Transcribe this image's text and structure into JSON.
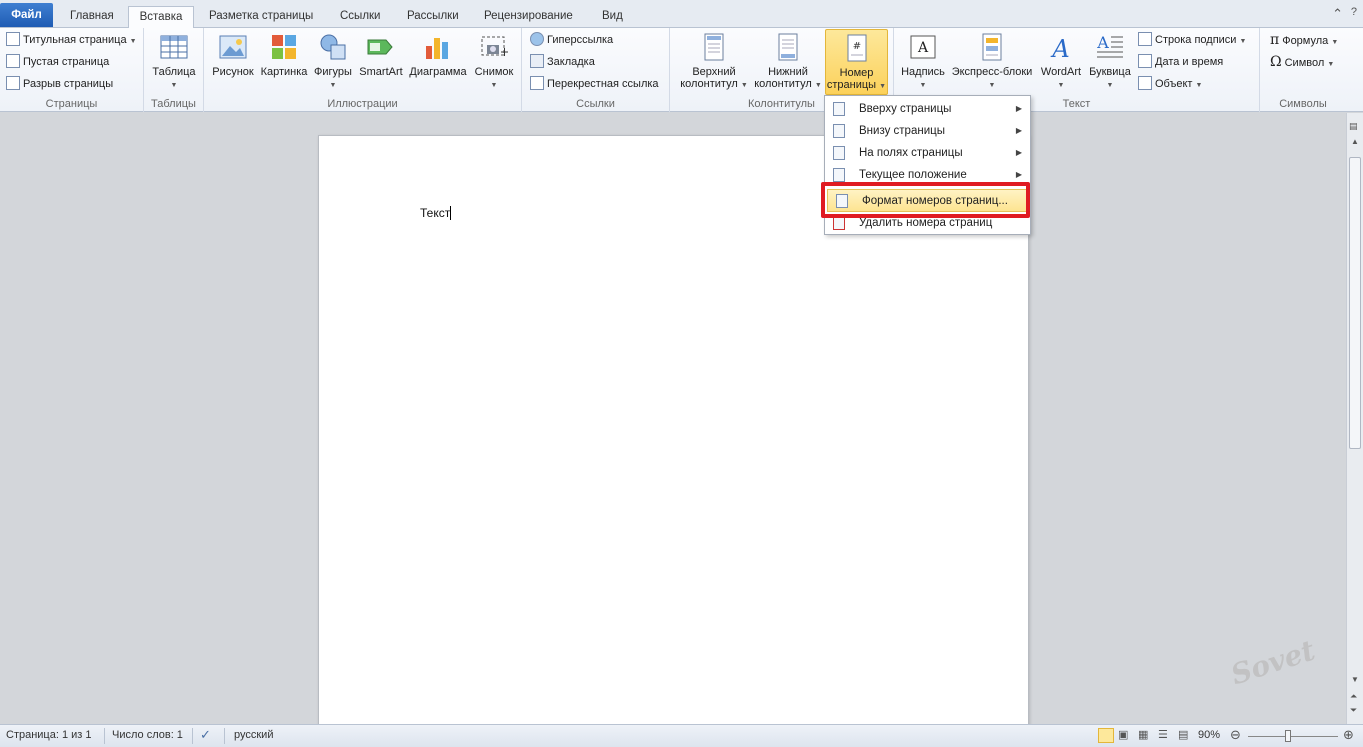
{
  "tabs": [
    "Файл",
    "Главная",
    "Вставка",
    "Разметка страницы",
    "Ссылки",
    "Рассылки",
    "Рецензирование",
    "Вид"
  ],
  "active_tab": "Вставка",
  "ribbon": {
    "pages_group": {
      "label": "Страницы",
      "items": [
        "Титульная страница",
        "Пустая страница",
        "Разрыв страницы"
      ]
    },
    "tables_group": {
      "label": "Таблицы",
      "table": "Таблица"
    },
    "illustrations_group": {
      "label": "Иллюстрации",
      "items": [
        "Рисунок",
        "Картинка",
        "Фигуры",
        "SmartArt",
        "Диаграмма",
        "Снимок"
      ]
    },
    "links_group": {
      "label": "Ссылки",
      "items": [
        "Гиперссылка",
        "Закладка",
        "Перекрестная ссылка"
      ]
    },
    "headers_group": {
      "label": "Колонтитулы",
      "header": [
        "Верхний",
        "колонтитул"
      ],
      "footer": [
        "Нижний",
        "колонтитул"
      ],
      "page_number": [
        "Номер",
        "страницы"
      ]
    },
    "text_group": {
      "label": "Текст",
      "items": [
        "Надпись",
        "Экспресс-блоки",
        "WordArt",
        "Буквица"
      ],
      "small": [
        "Строка подписи",
        "Дата и время",
        "Объект"
      ]
    },
    "symbols_group": {
      "label": "Символы",
      "items": [
        "Формула",
        "Символ"
      ]
    }
  },
  "menu": {
    "items": [
      "Вверху страницы",
      "Внизу страницы",
      "На полях страницы",
      "Текущее положение",
      "Формат номеров страниц...",
      "Удалить номера страниц"
    ]
  },
  "document": {
    "text": "Текст"
  },
  "status": {
    "page": "Страница: 1 из 1",
    "words": "Число слов: 1",
    "language": "русский",
    "zoom": "90%"
  },
  "colors": {
    "accent_red": "#e01b22",
    "file_tab": "#2a68c0"
  },
  "watermark": "Sovet"
}
